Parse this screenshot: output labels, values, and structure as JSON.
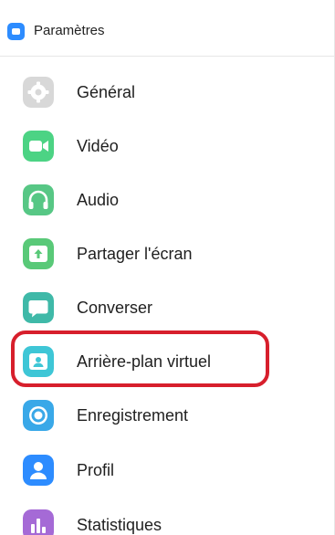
{
  "window": {
    "title": "Paramètres"
  },
  "nav": {
    "items": [
      {
        "label": "Général",
        "icon": "gear-icon",
        "color": "#d8d8d8"
      },
      {
        "label": "Vidéo",
        "icon": "video-camera-icon",
        "color": "#4cd384"
      },
      {
        "label": "Audio",
        "icon": "headphones-icon",
        "color": "#57c785"
      },
      {
        "label": "Partager l'écran",
        "icon": "share-screen-icon",
        "color": "#59c978"
      },
      {
        "label": "Converser",
        "icon": "chat-bubble-icon",
        "color": "#3fb9a8"
      },
      {
        "label": "Arrière-plan virtuel",
        "icon": "virtual-background-icon",
        "color": "#3ec6d6"
      },
      {
        "label": "Enregistrement",
        "icon": "record-icon",
        "color": "#39a8e8"
      },
      {
        "label": "Profil",
        "icon": "profile-icon",
        "color": "#2d8cff"
      },
      {
        "label": "Statistiques",
        "icon": "statistics-icon",
        "color": "#a56ad6"
      }
    ],
    "highlight_color": "#d71f2c"
  }
}
